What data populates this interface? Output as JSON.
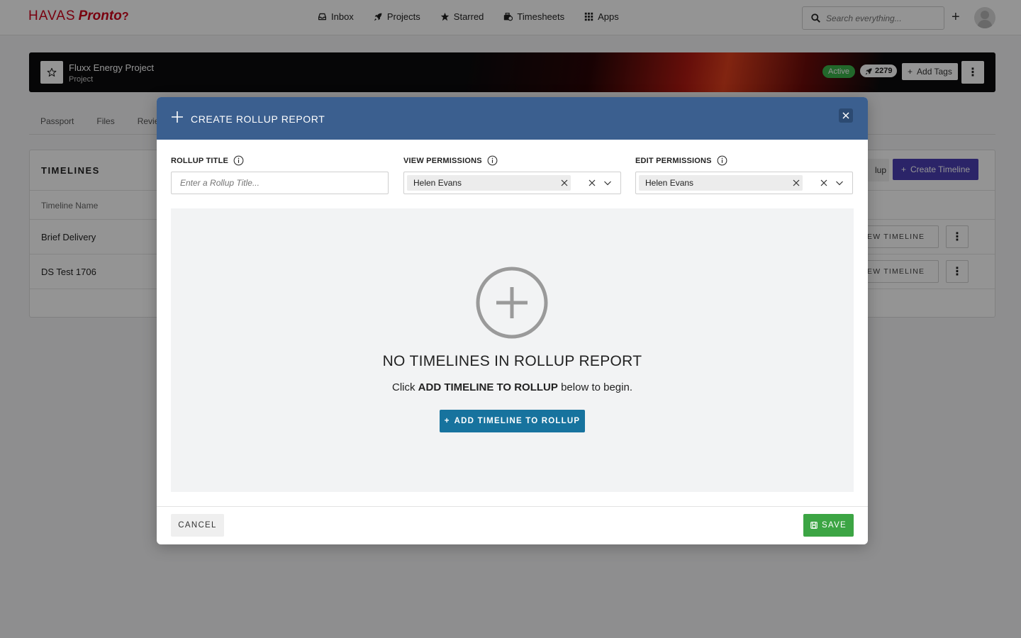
{
  "brand": {
    "part1": "HAVAS",
    "part2": "Pronto",
    "mark": "?"
  },
  "nav": {
    "items": [
      {
        "label": "Inbox",
        "icon": "inbox-icon"
      },
      {
        "label": "Projects",
        "icon": "rocket-icon"
      },
      {
        "label": "Starred",
        "icon": "star-icon"
      },
      {
        "label": "Timesheets",
        "icon": "timesheet-icon"
      },
      {
        "label": "Apps",
        "icon": "grid-icon"
      }
    ],
    "search_placeholder": "Search everything..."
  },
  "project": {
    "title": "Fluxx Energy Project",
    "subtitle": "Project",
    "status": "Active",
    "count": "2279",
    "add_tags_label": "Add Tags"
  },
  "tabs": [
    "Passport",
    "Files",
    "Revie"
  ],
  "timelines": {
    "title": "TIMELINES",
    "column_header": "Timeline Name",
    "create_label": "Create Timeline",
    "rollup_partial": "lup",
    "view_label": "EW TIMELINE",
    "rows": [
      "Brief Delivery",
      "DS Test 1706"
    ]
  },
  "modal": {
    "title": "CREATE ROLLUP REPORT",
    "rollup_title_label": "ROLLUP TITLE",
    "rollup_title_placeholder": "Enter a Rollup Title...",
    "view_permissions_label": "VIEW PERMISSIONS",
    "view_permissions_value": "Helen Evans",
    "edit_permissions_label": "EDIT PERMISSIONS",
    "edit_permissions_value": "Helen Evans",
    "empty_title": "NO TIMELINES IN ROLLUP REPORT",
    "empty_sub_pre": "Click",
    "empty_sub_bold": "ADD TIMELINE TO ROLLUP",
    "empty_sub_post": "below to begin.",
    "add_button": "ADD TIMELINE TO ROLLUP",
    "cancel": "CANCEL",
    "save": "SAVE"
  },
  "colors": {
    "modal_header": "#3b5f8f",
    "add_button": "#17739e",
    "save_button": "#3ca544",
    "create_timeline": "#4b3fb3",
    "brand_red": "#d0021b",
    "active_badge": "#3cb34a"
  }
}
